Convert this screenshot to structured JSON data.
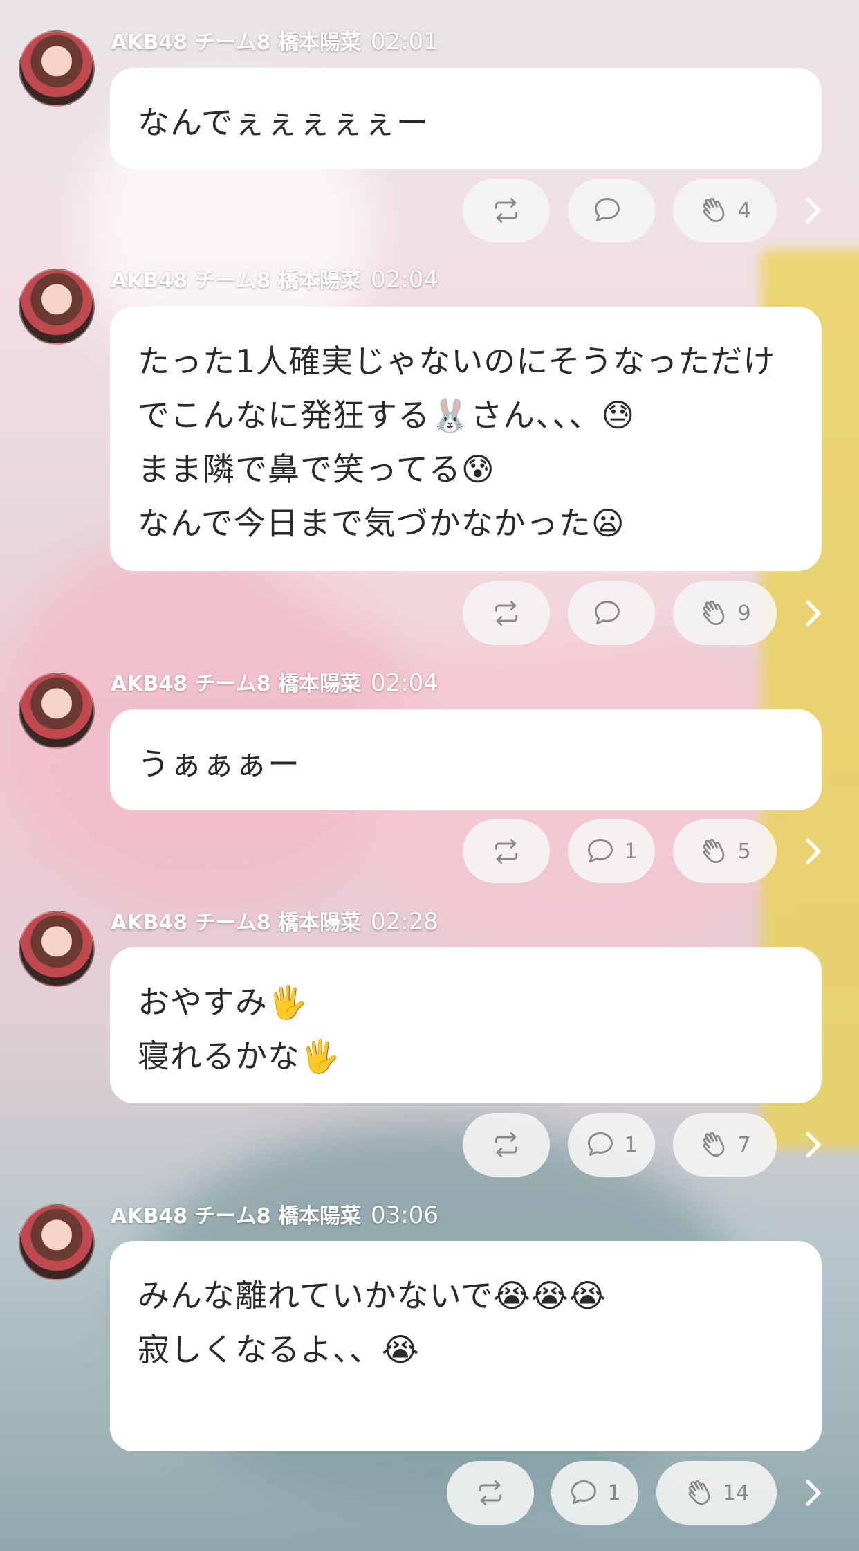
{
  "messages": [
    {
      "author": "AKB48 チーム8 橋本陽菜",
      "time": "02:01",
      "text": "なんでぇぇぇぇぇー",
      "counts": {
        "reply": "",
        "clap": "4"
      }
    },
    {
      "author": "AKB48 チーム8 橋本陽菜",
      "time": "02:04",
      "text": "たった1人確実じゃないのにそうなっただけでこんなに発狂する🐰さん、、、😓\nまま隣で鼻で笑ってる😰\nなんで今日まで気づかなかった😦",
      "counts": {
        "reply": "",
        "clap": "9"
      }
    },
    {
      "author": "AKB48 チーム8 橋本陽菜",
      "time": "02:04",
      "text": "うぁぁぁー",
      "counts": {
        "reply": "1",
        "clap": "5"
      }
    },
    {
      "author": "AKB48 チーム8 橋本陽菜",
      "time": "02:28",
      "text": "おやすみ🖐\n寝れるかな🖐",
      "counts": {
        "reply": "1",
        "clap": "7"
      }
    },
    {
      "author": "AKB48 チーム8 橋本陽菜",
      "time": "03:06",
      "text": "みんな離れていかないで😭😭😭\n寂しくなるよ、、😭",
      "counts": {
        "reply": "1",
        "clap": "14"
      }
    }
  ],
  "icons": {
    "retweet": "retweet-icon",
    "reply": "speech-bubble-icon",
    "clap": "clap-hand-icon",
    "more": "chevron-right-icon"
  },
  "colors": {
    "bubble": "#ffffff",
    "pill": "#f5f5f5",
    "meta_text": "#ffffff",
    "body_text": "#2a2a2a",
    "icon": "#8a8a8a"
  }
}
